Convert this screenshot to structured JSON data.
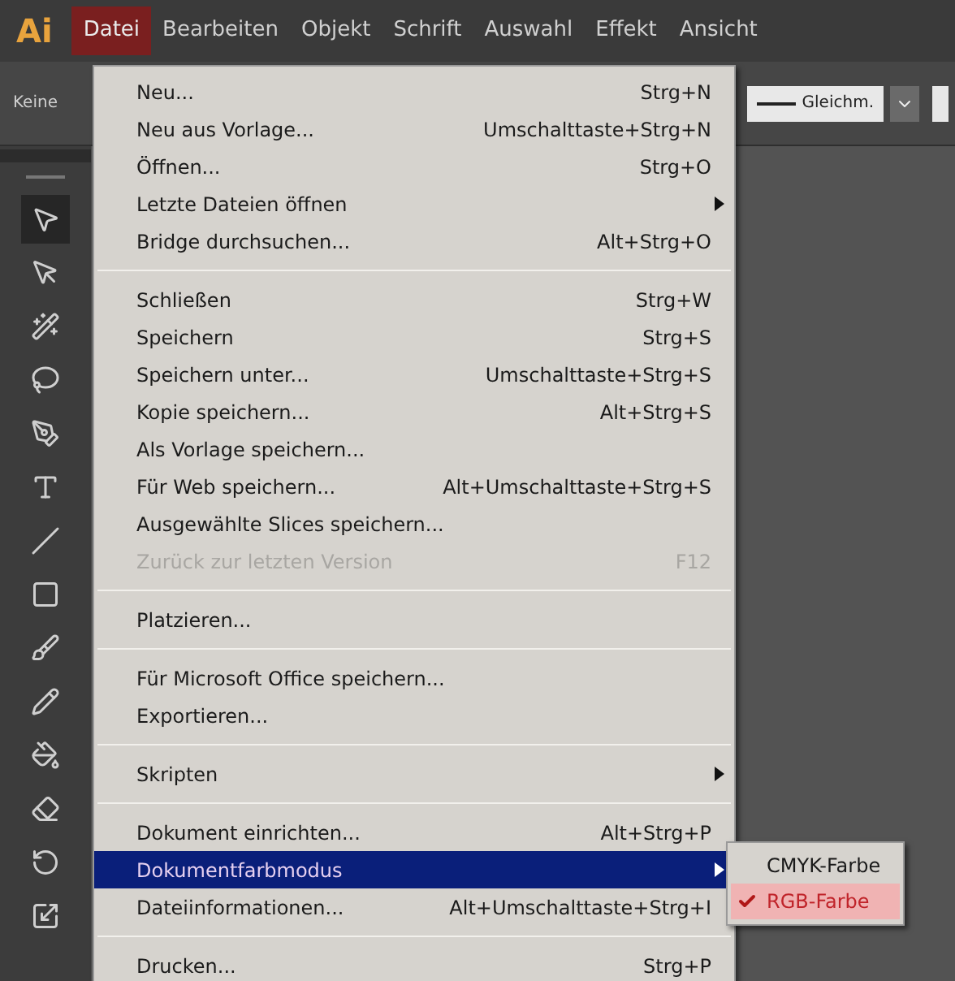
{
  "app_logo": "Ai",
  "menubar": [
    {
      "label": "Datei",
      "selected": true
    },
    {
      "label": "Bearbeiten",
      "selected": false
    },
    {
      "label": "Objekt",
      "selected": false
    },
    {
      "label": "Schrift",
      "selected": false
    },
    {
      "label": "Auswahl",
      "selected": false
    },
    {
      "label": "Effekt",
      "selected": false
    },
    {
      "label": "Ansicht",
      "selected": false
    }
  ],
  "control_bar": {
    "fill_label": "Keine",
    "stroke_profile": "Gleichm."
  },
  "file_menu": {
    "groups": [
      [
        {
          "label": "Neu...",
          "shortcut": "Strg+N",
          "submenu": false,
          "disabled": false,
          "selected": false
        },
        {
          "label": "Neu aus Vorlage...",
          "shortcut": "Umschalttaste+Strg+N",
          "submenu": false,
          "disabled": false,
          "selected": false
        },
        {
          "label": "Öffnen...",
          "shortcut": "Strg+O",
          "submenu": false,
          "disabled": false,
          "selected": false
        },
        {
          "label": "Letzte Dateien öffnen",
          "submenu": true,
          "disabled": false,
          "selected": false
        },
        {
          "label": "Bridge durchsuchen...",
          "shortcut": "Alt+Strg+O",
          "submenu": false,
          "disabled": false,
          "selected": false
        }
      ],
      [
        {
          "label": "Schließen",
          "shortcut": "Strg+W",
          "submenu": false,
          "disabled": false,
          "selected": false
        },
        {
          "label": "Speichern",
          "shortcut": "Strg+S",
          "submenu": false,
          "disabled": false,
          "selected": false
        },
        {
          "label": "Speichern unter...",
          "shortcut": "Umschalttaste+Strg+S",
          "submenu": false,
          "disabled": false,
          "selected": false
        },
        {
          "label": "Kopie speichern...",
          "shortcut": "Alt+Strg+S",
          "submenu": false,
          "disabled": false,
          "selected": false
        },
        {
          "label": "Als Vorlage speichern...",
          "submenu": false,
          "disabled": false,
          "selected": false
        },
        {
          "label": "Für Web speichern...",
          "shortcut": "Alt+Umschalttaste+Strg+S",
          "submenu": false,
          "disabled": false,
          "selected": false
        },
        {
          "label": "Ausgewählte Slices speichern...",
          "submenu": false,
          "disabled": false,
          "selected": false
        },
        {
          "label": "Zurück zur letzten Version",
          "shortcut": "F12",
          "submenu": false,
          "disabled": true,
          "selected": false
        }
      ],
      [
        {
          "label": "Platzieren...",
          "submenu": false,
          "disabled": false,
          "selected": false
        }
      ],
      [
        {
          "label": "Für Microsoft Office speichern...",
          "submenu": false,
          "disabled": false,
          "selected": false
        },
        {
          "label": "Exportieren...",
          "submenu": false,
          "disabled": false,
          "selected": false
        }
      ],
      [
        {
          "label": "Skripten",
          "submenu": true,
          "disabled": false,
          "selected": false
        }
      ],
      [
        {
          "label": "Dokument einrichten...",
          "shortcut": "Alt+Strg+P",
          "submenu": false,
          "disabled": false,
          "selected": false
        },
        {
          "label": "Dokumentfarbmodus",
          "submenu": true,
          "disabled": false,
          "selected": true
        },
        {
          "label": "Dateiinformationen...",
          "shortcut": "Alt+Umschalttaste+Strg+I",
          "submenu": false,
          "disabled": false,
          "selected": false
        }
      ],
      [
        {
          "label": "Drucken...",
          "shortcut": "Strg+P",
          "submenu": false,
          "disabled": false,
          "selected": false
        }
      ]
    ]
  },
  "color_mode_submenu": [
    {
      "label": "CMYK-Farbe",
      "checked": false,
      "selected": false
    },
    {
      "label": "RGB-Farbe",
      "checked": true,
      "selected": true
    }
  ]
}
